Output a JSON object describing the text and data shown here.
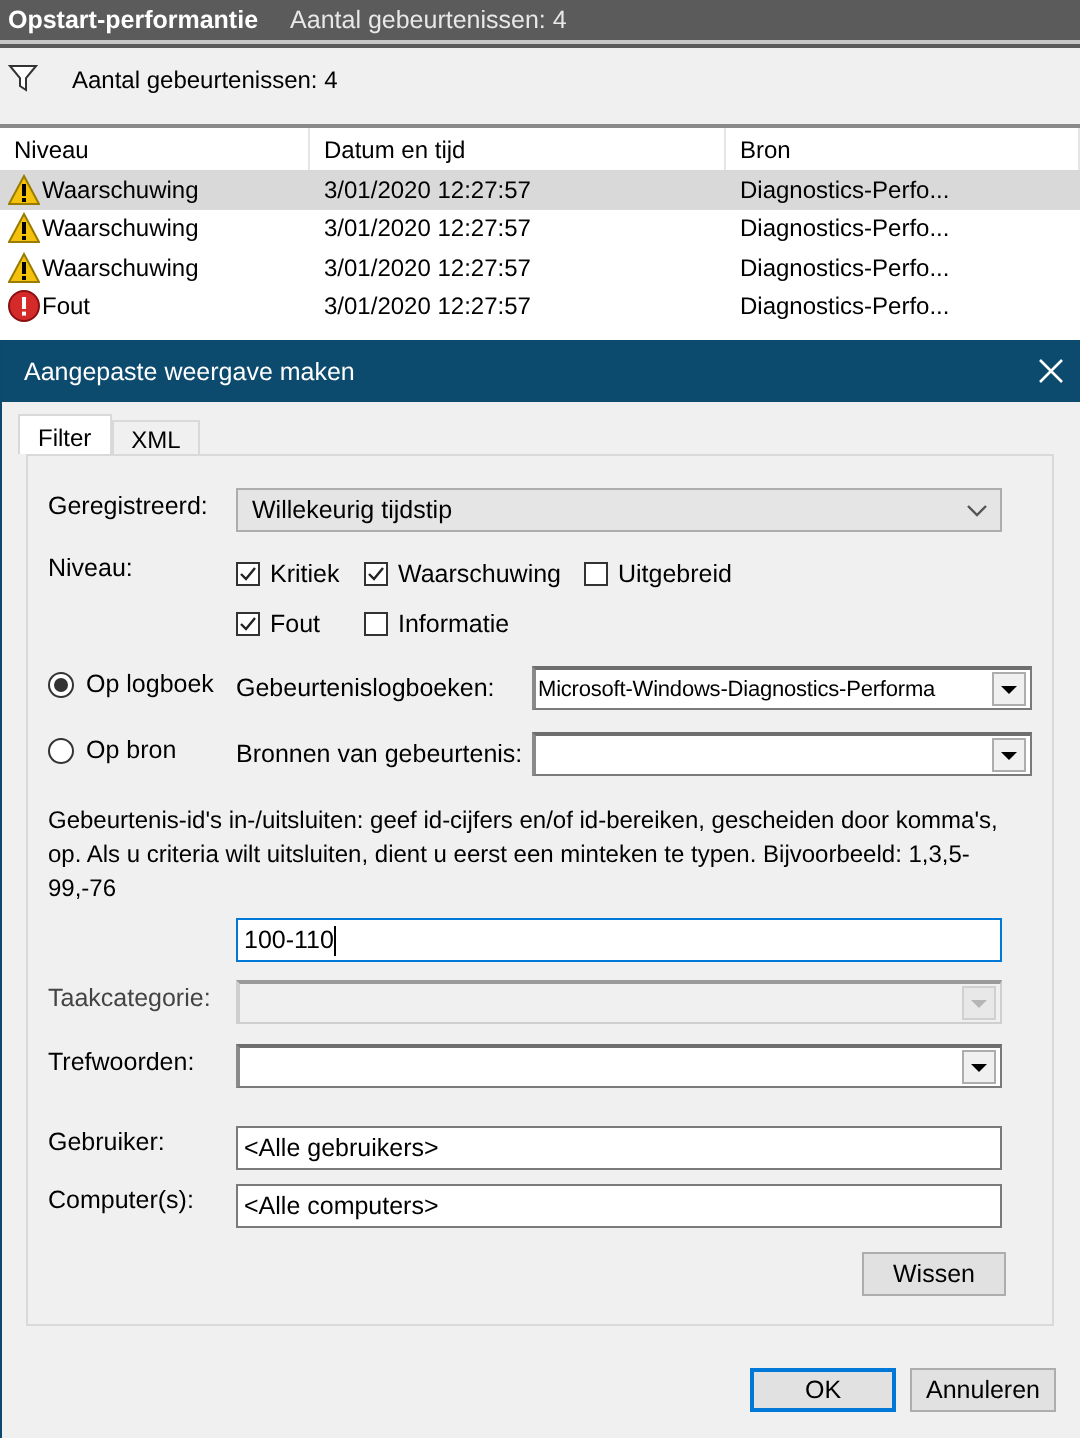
{
  "log_header": {
    "title": "Opstart-performantie",
    "count": "Aantal gebeurtenissen: 4"
  },
  "filter_bar": {
    "text": "Aantal gebeurtenissen: 4"
  },
  "table": {
    "columns": [
      "Niveau",
      "Datum en tijd",
      "Bron"
    ],
    "rows": [
      {
        "kind": "warning",
        "level": "Waarschuwing",
        "date": "3/01/2020 12:27:57",
        "source": "Diagnostics-Perfo...",
        "selected": true
      },
      {
        "kind": "warning",
        "level": "Waarschuwing",
        "date": "3/01/2020 12:27:57",
        "source": "Diagnostics-Perfo...",
        "selected": false
      },
      {
        "kind": "warning",
        "level": "Waarschuwing",
        "date": "3/01/2020 12:27:57",
        "source": "Diagnostics-Perfo...",
        "selected": false
      },
      {
        "kind": "error",
        "level": "Fout",
        "date": "3/01/2020 12:27:57",
        "source": "Diagnostics-Perfo...",
        "selected": false
      }
    ]
  },
  "dialog": {
    "title": "Aangepaste weergave maken",
    "tabs": [
      {
        "label": "Filter",
        "selected": true
      },
      {
        "label": "XML",
        "selected": false
      }
    ],
    "logged": {
      "label": "Geregistreerd:",
      "value": "Willekeurig tijdstip"
    },
    "level": {
      "label": "Niveau:",
      "options": [
        {
          "label": "Kritiek",
          "checked": true
        },
        {
          "label": "Waarschuwing",
          "checked": true
        },
        {
          "label": "Uitgebreid",
          "checked": false
        },
        {
          "label": "Fout",
          "checked": true
        },
        {
          "label": "Informatie",
          "checked": false
        }
      ]
    },
    "scope": [
      {
        "label": "Op logboek",
        "selected": true,
        "field_label": "Gebeurtenislogboeken:",
        "value": "Microsoft-Windows-Diagnostics-Performa"
      },
      {
        "label": "Op bron",
        "selected": false,
        "field_label": "Bronnen van gebeurtenis:"
      }
    ],
    "event_ids": {
      "description": "Gebeurtenis-id's in-/uitsluiten: geef id-cijfers en/of id-bereiken, gescheiden door komma's, op. Als u criteria wilt uitsluiten, dient u eerst een minteken te typen. Bijvoorbeeld: 1,3,5-99,-76",
      "value": "100-110"
    },
    "task_category": {
      "label": "Taakcategorie:",
      "disabled": true
    },
    "keywords": {
      "label": "Trefwoorden:",
      "disabled": false
    },
    "user": {
      "label": "Gebruiker:",
      "value": "<Alle gebruikers>"
    },
    "computer": {
      "label": "Computer(s):",
      "value": "<Alle computers>"
    },
    "clear_button": "Wissen",
    "buttons": [
      {
        "label": "OK",
        "default": true
      },
      {
        "label": "Annuleren",
        "default": false
      }
    ]
  }
}
